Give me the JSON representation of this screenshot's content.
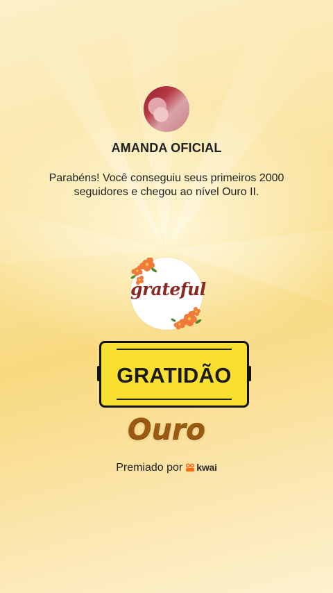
{
  "profile": {
    "name": "AMANDA OFICIAL",
    "message": "Parabéns! Você conseguiu seus primeiros 2000 seguidores e chegou ao nível Ouro II."
  },
  "badge": {
    "word": "grateful",
    "title": "GRATIDÃO",
    "level": "Ouro"
  },
  "footer": {
    "awarded_by": "Premiado por",
    "brand": "kwai"
  },
  "colors": {
    "banner": "#f9df2f",
    "level": "#9a5a12",
    "brand_icon": "#ff6a10",
    "badge_text": "#8a2a21"
  }
}
